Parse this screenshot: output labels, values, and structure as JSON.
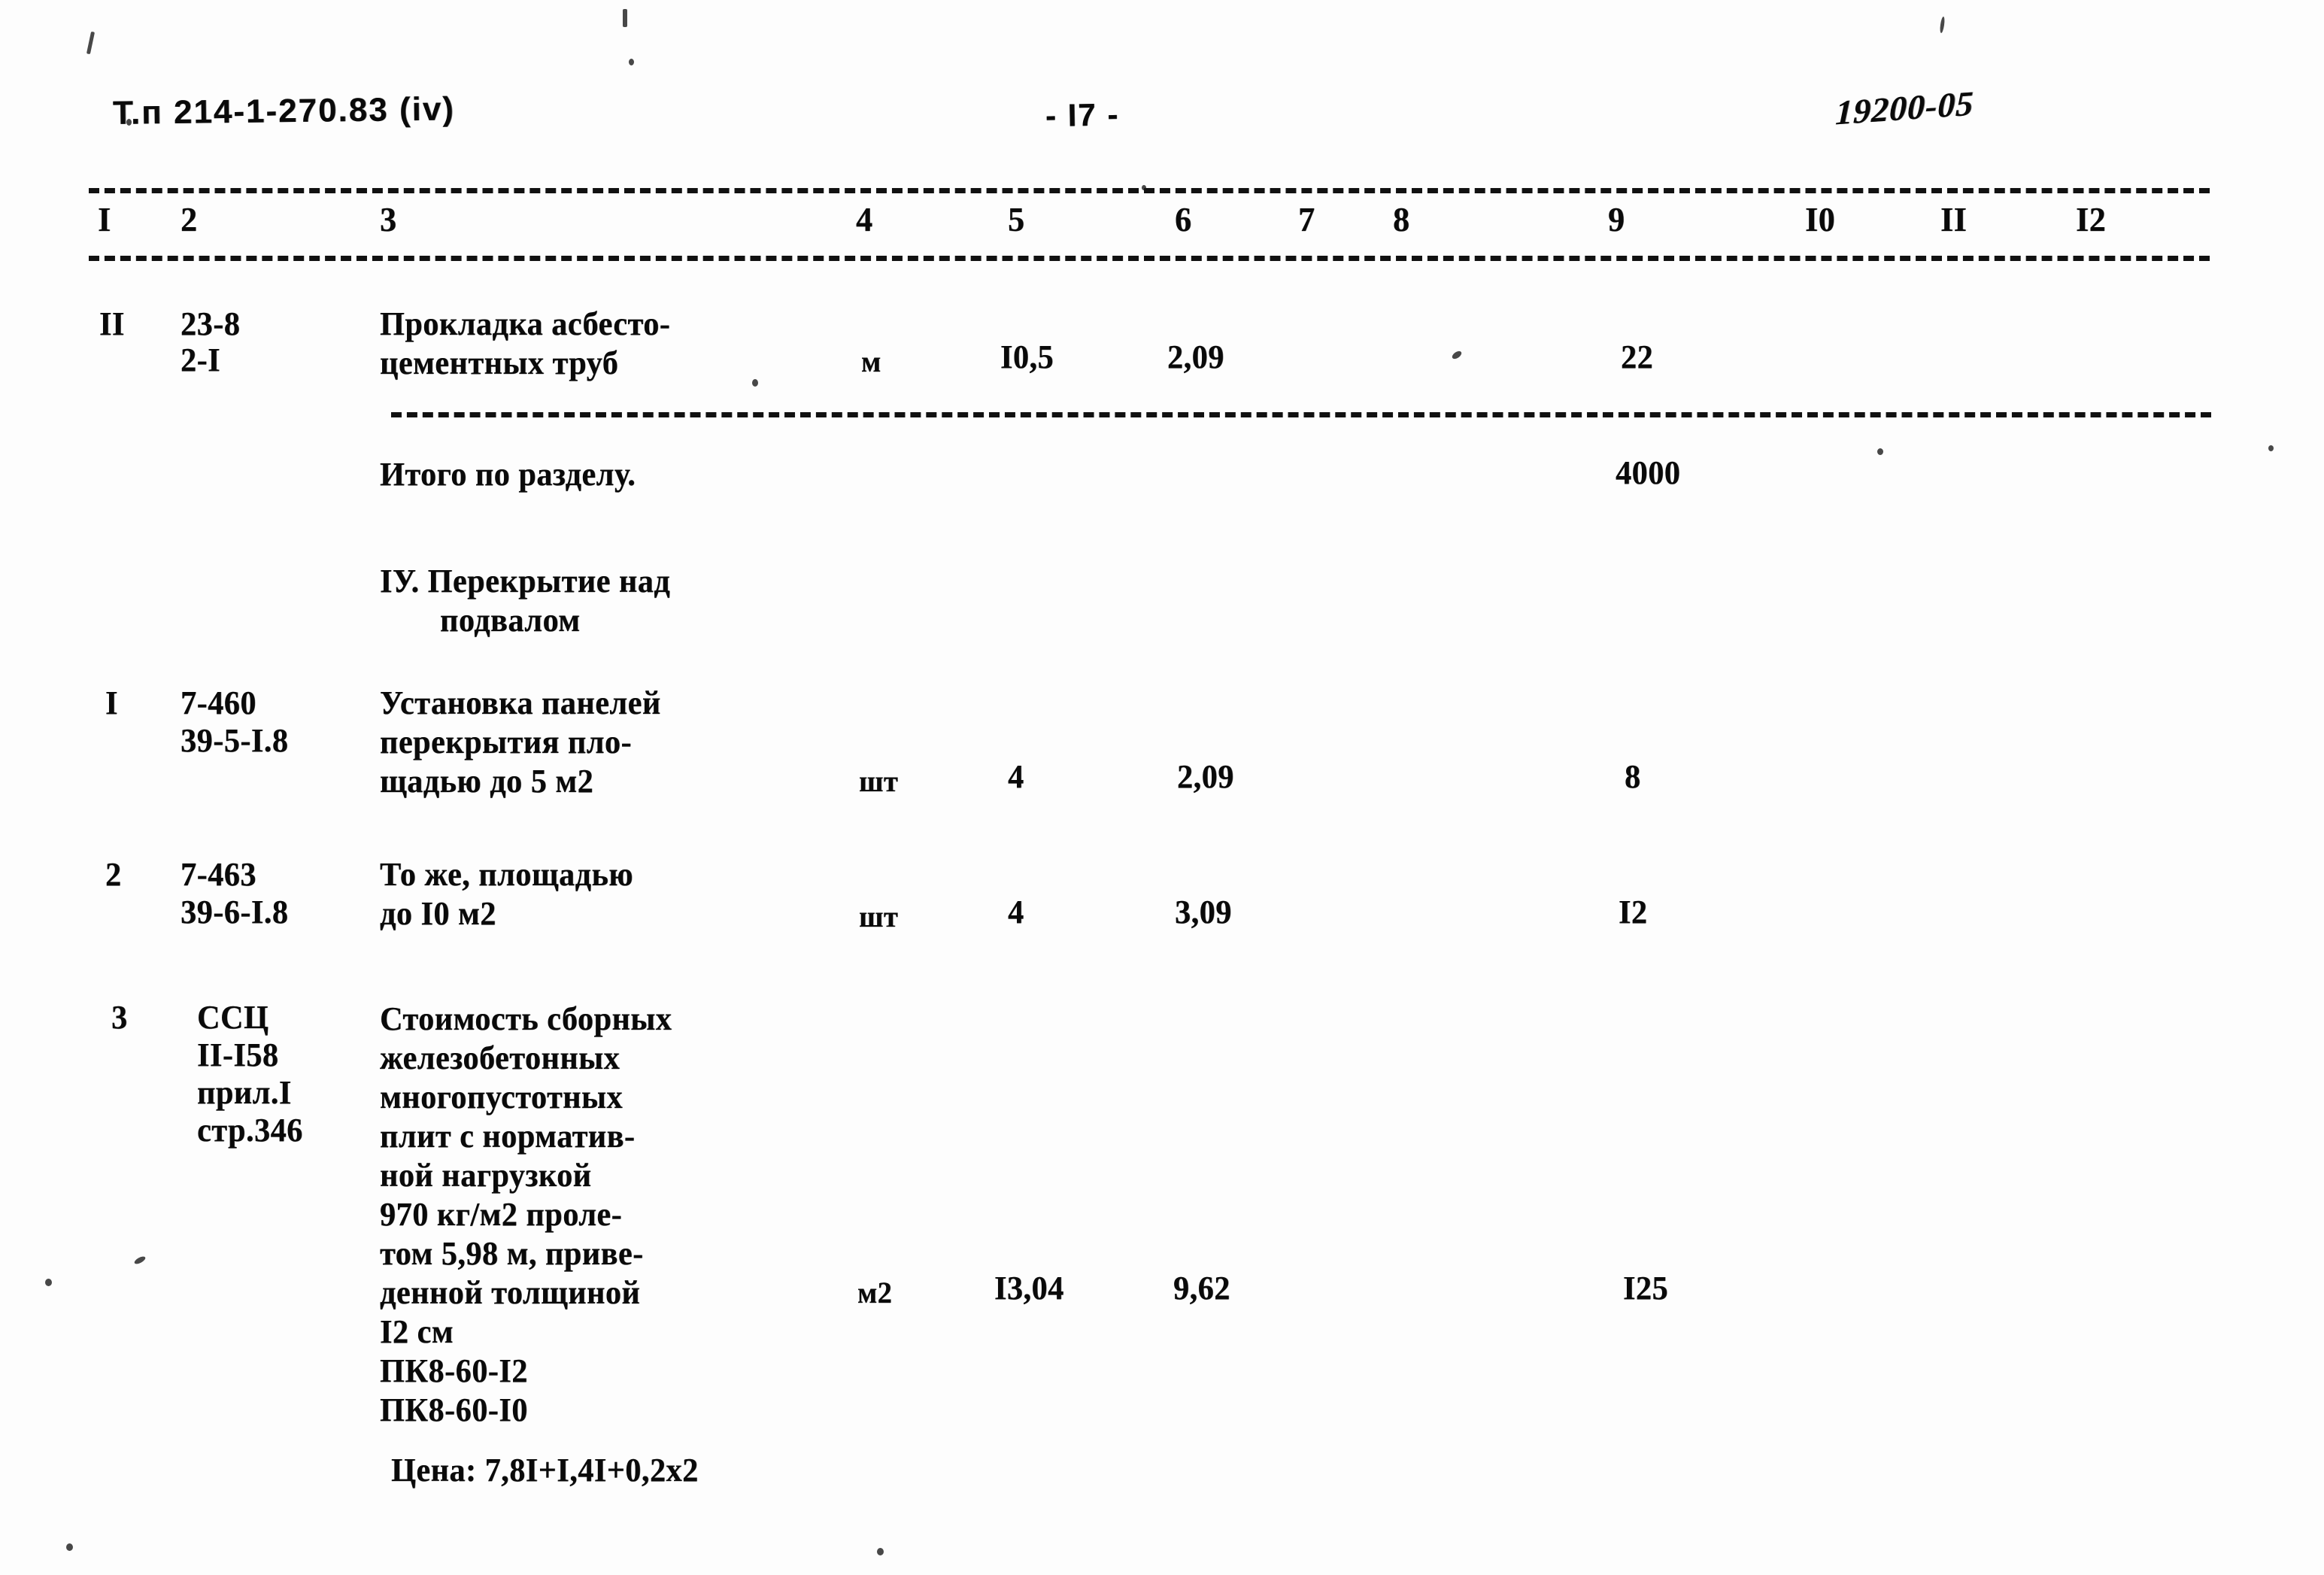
{
  "document": {
    "series_code": "Т.п 214-1-270.83 (iv)",
    "page_label": "- I7 -",
    "sheet_code": "19200-05"
  },
  "table": {
    "column_headers": [
      "I",
      "2",
      "3",
      "4",
      "5",
      "6",
      "7",
      "8",
      "9",
      "I0",
      "II",
      "I2"
    ],
    "rows": [
      {
        "type": "item",
        "num": "II",
        "code_lines": [
          "23-8",
          "2-I"
        ],
        "desc_lines": [
          "Прокладка асбесто-",
          "цементных труб"
        ],
        "unit": "м",
        "qty": "I0,5",
        "price": "2,09",
        "col7": "",
        "col8": "",
        "total": "22"
      },
      {
        "type": "subtotal",
        "num": "",
        "code_lines": [],
        "desc_lines": [
          "Итого по разделу."
        ],
        "unit": "",
        "qty": "",
        "price": "",
        "col7": "",
        "col8": "",
        "total": "4000"
      },
      {
        "type": "section",
        "num": "",
        "code_lines": [],
        "desc_lines": [
          "IУ. Перекрытие над",
          "подвалом"
        ],
        "unit": "",
        "qty": "",
        "price": "",
        "col7": "",
        "col8": "",
        "total": ""
      },
      {
        "type": "item",
        "num": "I",
        "code_lines": [
          "7-460",
          "39-5-I.8"
        ],
        "desc_lines": [
          "Установка панелей",
          "перекрытия пло-",
          "щадью до 5 м2"
        ],
        "unit": "шт",
        "qty": "4",
        "price": "2,09",
        "col7": "",
        "col8": "",
        "total": "8"
      },
      {
        "type": "item",
        "num": "2",
        "code_lines": [
          "7-463",
          "39-6-I.8"
        ],
        "desc_lines": [
          "То же, площадью",
          "до I0 м2"
        ],
        "unit": "шт",
        "qty": "4",
        "price": "3,09",
        "col7": "",
        "col8": "",
        "total": "I2"
      },
      {
        "type": "item",
        "num": "3",
        "code_lines": [
          "ССЦ",
          "II-I58",
          "прил.I",
          "стр.346"
        ],
        "desc_lines": [
          "Стоимость сборных",
          "железобетонных",
          "многопустотных",
          "плит с норматив-",
          "ной нагрузкой",
          "970 кг/м2 проле-",
          "том 5,98 м, приве-",
          "денной толщиной",
          "I2 см",
          "ПК8-60-I2",
          "ПК8-60-I0"
        ],
        "unit": "м2",
        "qty": "I3,04",
        "price": "9,62",
        "col7": "",
        "col8": "",
        "total": "I25"
      },
      {
        "type": "note",
        "num": "",
        "code_lines": [],
        "desc_lines": [
          "Цена: 7,8I+I,4I+0,2x2"
        ],
        "unit": "",
        "qty": "",
        "price": "",
        "col7": "",
        "col8": "",
        "total": ""
      }
    ]
  }
}
